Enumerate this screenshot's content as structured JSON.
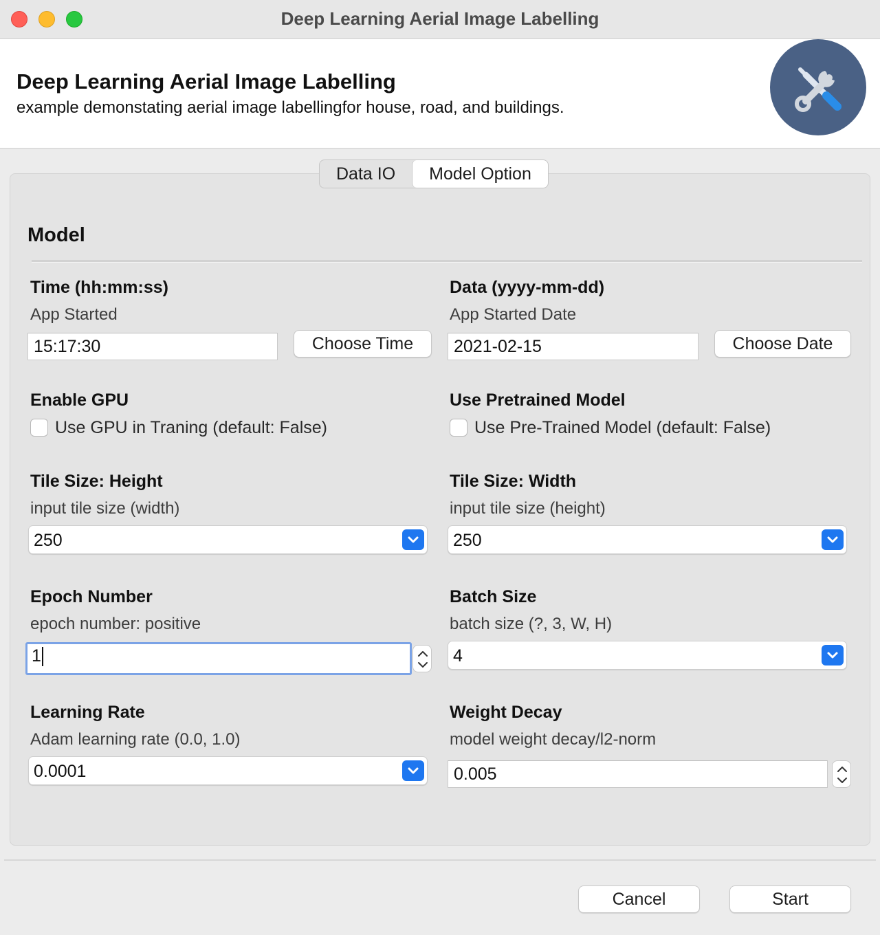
{
  "window": {
    "title": "Deep Learning Aerial Image Labelling"
  },
  "header": {
    "title": "Deep Learning Aerial Image Labelling",
    "subtitle": "example demonstating aerial image labellingfor house, road, and buildings.",
    "icon": "tools-icon"
  },
  "tabs": [
    {
      "label": "Data IO",
      "active": false
    },
    {
      "label": "Model Option",
      "active": true
    }
  ],
  "section": {
    "title": "Model"
  },
  "fields": {
    "time": {
      "label": "Time (hh:mm:ss)",
      "description": "App Started",
      "value": "15:17:30",
      "button": "Choose Time"
    },
    "date": {
      "label": "Data (yyyy-mm-dd)",
      "description": "App Started Date",
      "value": "2021-02-15",
      "button": "Choose Date"
    },
    "gpu": {
      "label": "Enable GPU",
      "checkbox_label": "Use GPU in Traning (default: False)",
      "checked": false
    },
    "pretrained": {
      "label": "Use Pretrained Model",
      "checkbox_label": "Use Pre-Trained Model (default: False)",
      "checked": false
    },
    "tile_height": {
      "label": "Tile Size: Height",
      "description": "input tile size (width)",
      "value": "250"
    },
    "tile_width": {
      "label": "Tile Size: Width",
      "description": "input tile size (height)",
      "value": "250"
    },
    "epoch": {
      "label": "Epoch Number",
      "description": "epoch number: positive",
      "value": "1"
    },
    "batch": {
      "label": "Batch Size",
      "description": "batch size (?, 3, W, H)",
      "value": "4"
    },
    "learning_rate": {
      "label": "Learning Rate",
      "description": "Adam learning rate (0.0, 1.0)",
      "value": "0.0001"
    },
    "weight_decay": {
      "label": "Weight Decay",
      "description": "model weight decay/l2-norm",
      "value": "0.005"
    }
  },
  "footer": {
    "cancel": "Cancel",
    "start": "Start"
  },
  "colors": {
    "accent": "#1e77f0",
    "focus_ring": "#7ba3e6",
    "icon_bg": "#4a6185"
  }
}
